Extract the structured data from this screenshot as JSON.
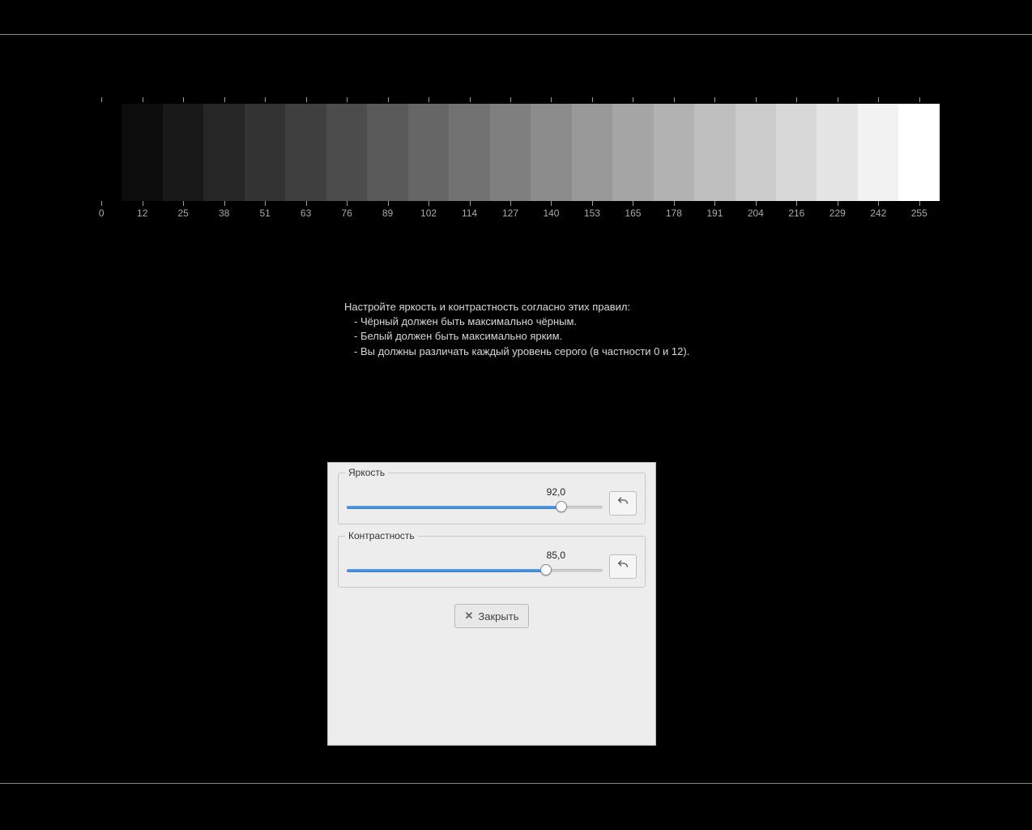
{
  "gradient": {
    "tick_values": [
      0,
      12,
      25,
      38,
      51,
      63,
      76,
      89,
      102,
      114,
      127,
      140,
      153,
      165,
      178,
      191,
      204,
      216,
      229,
      242,
      255
    ]
  },
  "instructions": {
    "heading": "Настройте яркость и контрастность согласно этих правил:",
    "rules": [
      "- Чёрный должен быть максимально чёрным.",
      "- Белый должен быть максимально ярким.",
      "- Вы должны различать каждый уровень серого (в частности 0 и 12)."
    ]
  },
  "panel": {
    "brightness": {
      "label": "Яркость",
      "value_text": "92,0",
      "value_percent": 84
    },
    "contrast": {
      "label": "Контрастность",
      "value_text": "85,0",
      "value_percent": 78
    },
    "close_label": "Закрыть"
  }
}
